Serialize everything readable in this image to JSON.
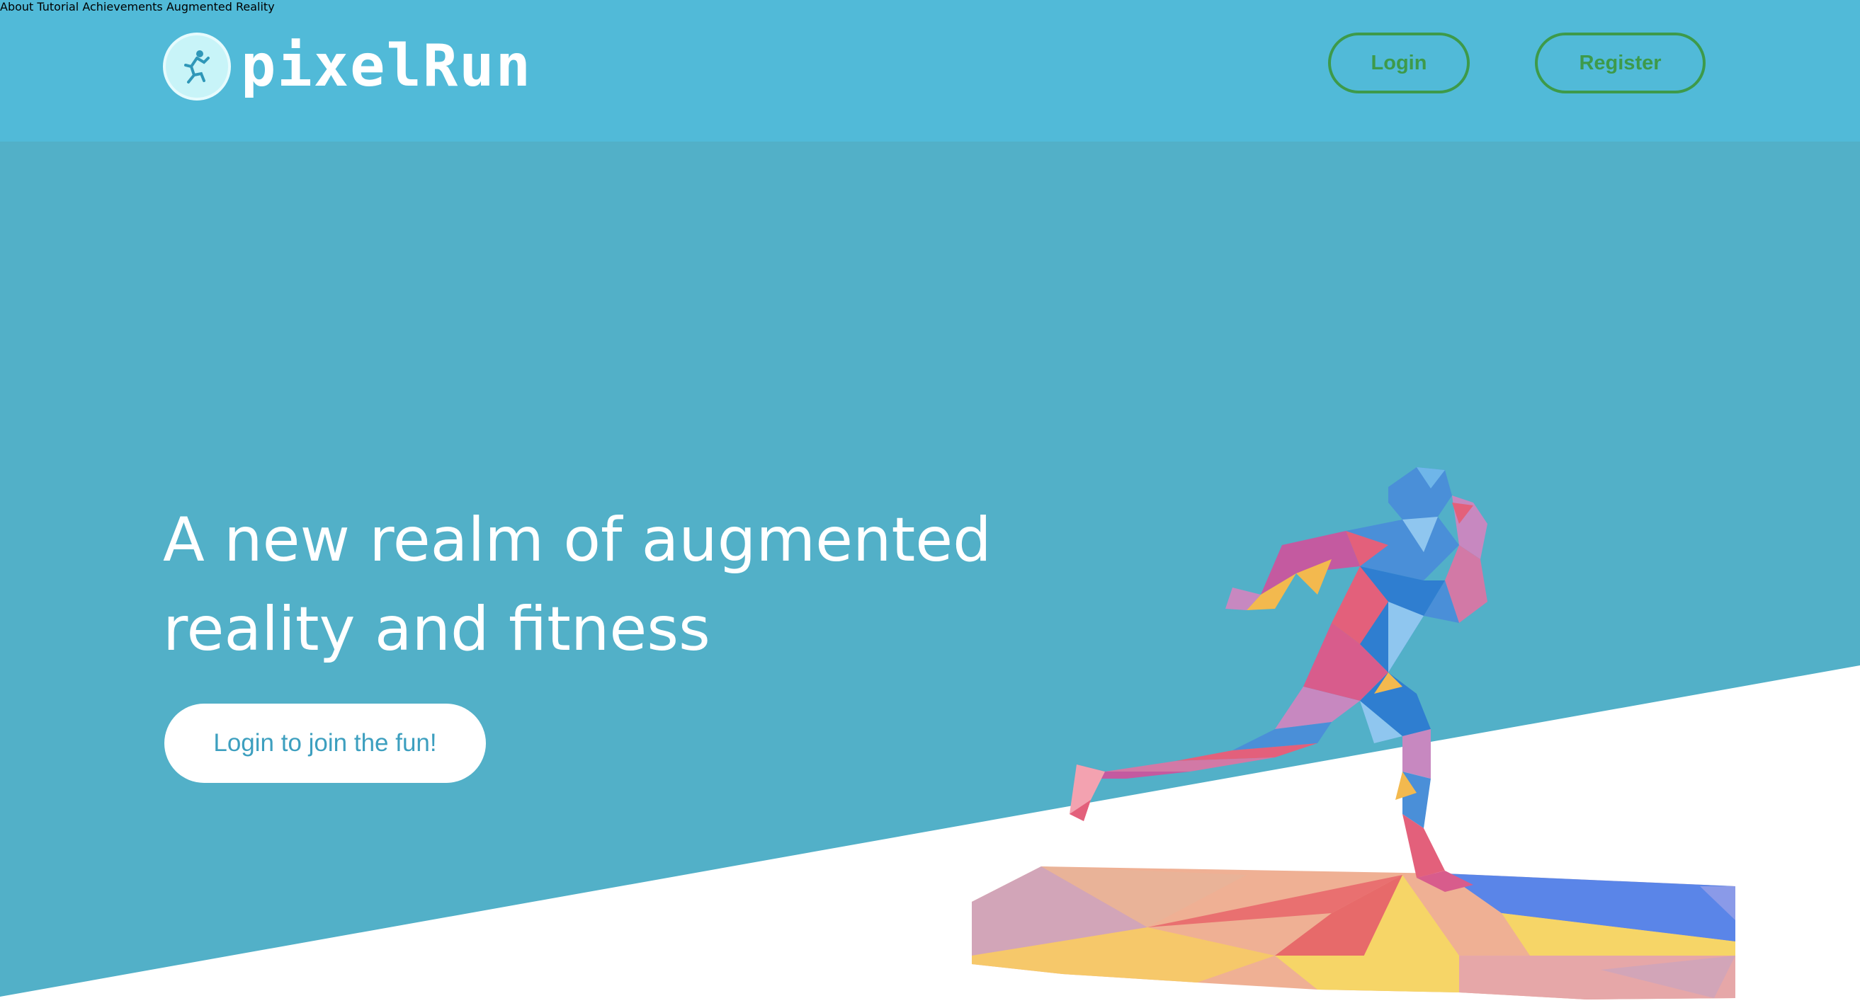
{
  "header": {
    "logo_text": "pixelRun",
    "nav": [
      {
        "label": "About"
      },
      {
        "label": "Tutorial"
      },
      {
        "label": "Achievements"
      },
      {
        "label": "Augmented Reality"
      }
    ],
    "login_label": "Login",
    "register_label": "Register"
  },
  "hero": {
    "title_line1": "A new realm of augmented",
    "title_line2": "reality and fitness",
    "cta_label": "Login to join the fun!"
  },
  "icons": {
    "logo": "runner-logo-icon",
    "illustration": "geometric-runner-illustration"
  },
  "colors": {
    "header_bg": "#51bad8",
    "hero_bg": "#52b0c8",
    "button_outline": "#3d9a4a",
    "cta_text": "#3d9fbf"
  }
}
